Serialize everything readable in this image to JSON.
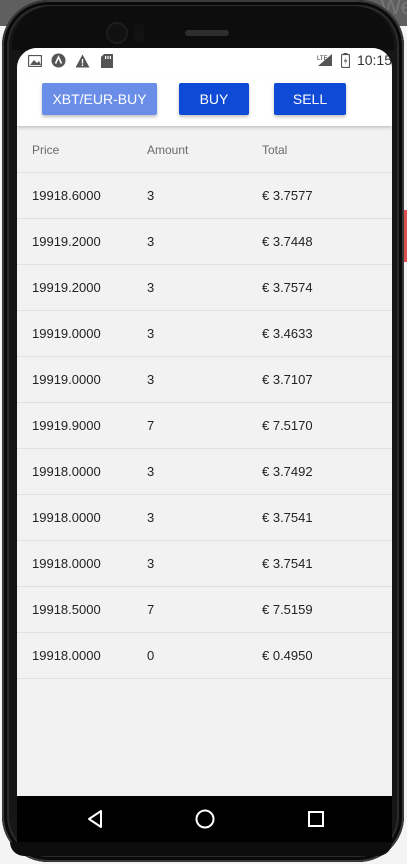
{
  "desktop": {
    "partial_title": "We"
  },
  "status_bar": {
    "icons_left": [
      "image-icon",
      "app-icon",
      "warning-icon",
      "sd-card-icon"
    ],
    "network_label": "LTE",
    "time": "10:15"
  },
  "header": {
    "pair_button": "XBT/EUR-BUY",
    "buy_button": "BUY",
    "sell_button": "SELL"
  },
  "table": {
    "columns": [
      "Price",
      "Amount",
      "Total"
    ],
    "rows": [
      {
        "price": "19918.6000",
        "amount": "3",
        "total": "€ 3.7577"
      },
      {
        "price": "19919.2000",
        "amount": "3",
        "total": "€ 3.7448"
      },
      {
        "price": "19919.2000",
        "amount": "3",
        "total": "€ 3.7574"
      },
      {
        "price": "19919.0000",
        "amount": "3",
        "total": "€ 3.4633"
      },
      {
        "price": "19919.0000",
        "amount": "3",
        "total": "€ 3.7107"
      },
      {
        "price": "19919.9000",
        "amount": "7",
        "total": "€ 7.5170"
      },
      {
        "price": "19918.0000",
        "amount": "3",
        "total": "€ 3.7492"
      },
      {
        "price": "19918.0000",
        "amount": "3",
        "total": "€ 3.7541"
      },
      {
        "price": "19918.0000",
        "amount": "3",
        "total": "€ 3.7541"
      },
      {
        "price": "19918.5000",
        "amount": "7",
        "total": "€ 7.5159"
      },
      {
        "price": "19918.0000",
        "amount": "0",
        "total": "€ 0.4950"
      }
    ]
  },
  "nav": [
    "back-icon",
    "home-icon",
    "recents-icon"
  ],
  "colors": {
    "primary": "#0f4ad6",
    "primary_light": "#6a8ee8"
  }
}
